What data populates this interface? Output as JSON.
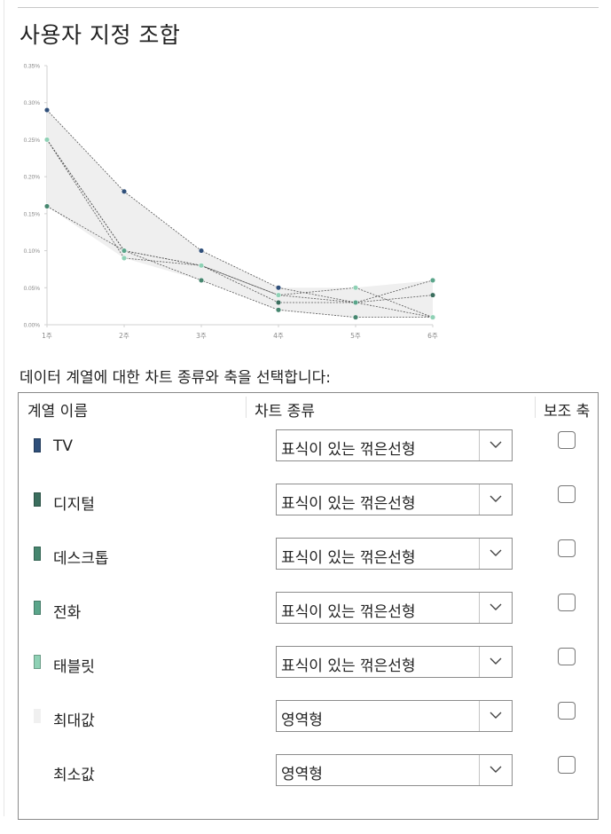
{
  "dialog": {
    "title": "사용자 지정 조합",
    "instruction": "데이터 계열에 대한 차트 종류와 축을 선택합니다:"
  },
  "table": {
    "headers": {
      "name": "계열 이름",
      "chart_type": "차트 종류",
      "secondary_axis": "보조 축"
    },
    "rows": [
      {
        "name": "TV",
        "color": "#2f4f7a",
        "chart_type": "표식이 있는 꺾은선형",
        "secondary_axis": false
      },
      {
        "name": "디지털",
        "color": "#3b6e5e",
        "chart_type": "표식이 있는 꺾은선형",
        "secondary_axis": false
      },
      {
        "name": "데스크톱",
        "color": "#46866f",
        "chart_type": "표식이 있는 꺾은선형",
        "secondary_axis": false
      },
      {
        "name": "전화",
        "color": "#5aa58a",
        "chart_type": "표식이 있는 꺾은선형",
        "secondary_axis": false
      },
      {
        "name": "태블릿",
        "color": "#8fd1b5",
        "chart_type": "표식이 있는 꺾은선형",
        "secondary_axis": false
      },
      {
        "name": "최대값",
        "color": "#f0f0f0",
        "chart_type": "영역형",
        "secondary_axis": false
      },
      {
        "name": "최소값",
        "color": "",
        "chart_type": "영역형",
        "secondary_axis": false
      }
    ]
  },
  "chart_data": {
    "type": "line",
    "categories": [
      "1주",
      "2주",
      "3주",
      "4주",
      "5주",
      "6주"
    ],
    "y_ticks": [
      "0.00%",
      "0.05%",
      "0.10%",
      "0.15%",
      "0.20%",
      "0.25%",
      "0.30%",
      "0.35%"
    ],
    "ylim": [
      0,
      0.35
    ],
    "band": {
      "upper": [
        0.29,
        0.18,
        0.1,
        0.05,
        0.05,
        0.06
      ],
      "lower": [
        0.16,
        0.09,
        0.06,
        0.02,
        0.01,
        0.01
      ],
      "color": "#efefef"
    },
    "series": [
      {
        "values": [
          0.29,
          0.18,
          0.1,
          0.05,
          0.03,
          0.01
        ],
        "color": "#2f4f7a"
      },
      {
        "values": [
          0.25,
          0.1,
          0.08,
          0.03,
          0.03,
          0.04
        ],
        "color": "#3b6e5e"
      },
      {
        "values": [
          0.16,
          0.1,
          0.06,
          0.02,
          0.01,
          0.01
        ],
        "color": "#46866f"
      },
      {
        "values": [
          0.25,
          0.1,
          0.08,
          0.04,
          0.03,
          0.06
        ],
        "color": "#5aa58a"
      },
      {
        "values": [
          0.25,
          0.09,
          0.08,
          0.04,
          0.05,
          0.01
        ],
        "color": "#8fd1b5"
      }
    ]
  }
}
